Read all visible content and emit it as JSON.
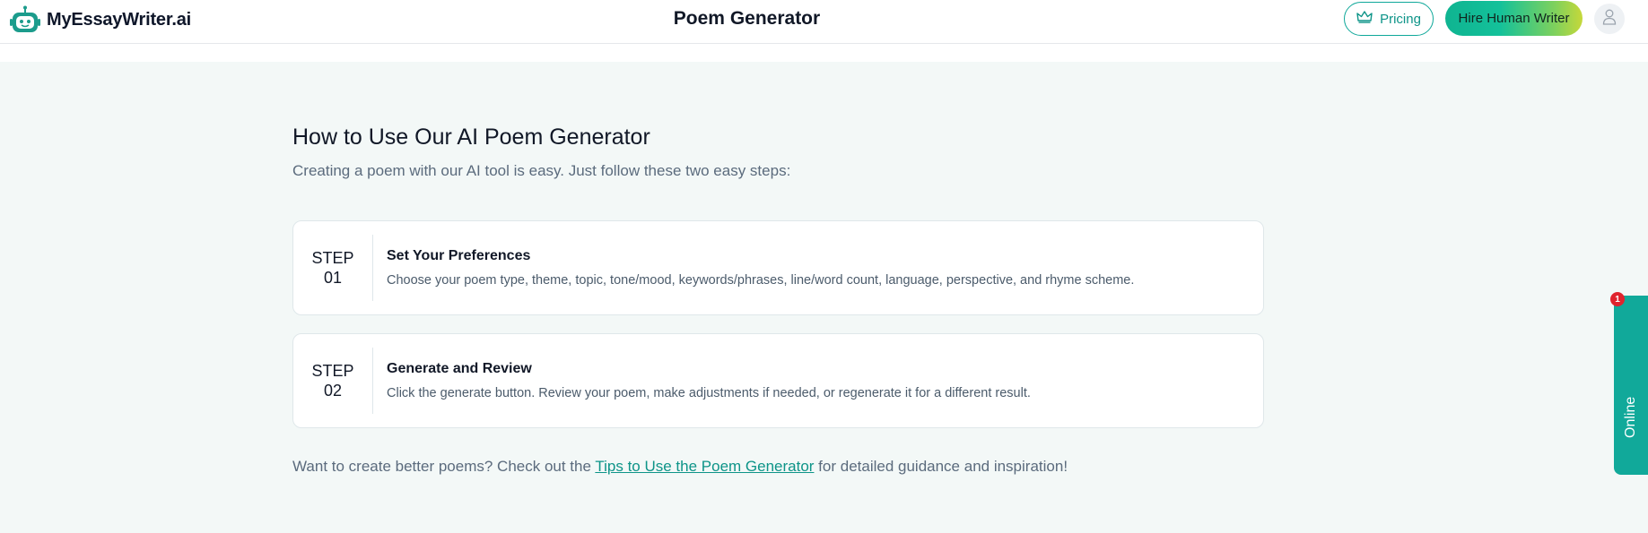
{
  "header": {
    "logo_text": "MyEssayWriter.ai",
    "page_title": "Poem Generator",
    "pricing_label": "Pricing",
    "hire_label": "Hire Human Writer"
  },
  "main": {
    "title": "How to Use Our AI Poem Generator",
    "subtitle": "Creating a poem with our AI tool is easy. Just follow these two easy steps:",
    "steps": [
      {
        "step_word": "STEP",
        "step_num": "01",
        "heading": "Set Your Preferences",
        "description": "Choose your poem type, theme, topic, tone/mood, keywords/phrases, line/word count, language, perspective, and rhyme scheme."
      },
      {
        "step_word": "STEP",
        "step_num": "02",
        "heading": "Generate and Review",
        "description": "Click the generate button. Review your poem, make adjustments if needed, or regenerate it for a different result."
      }
    ],
    "tips_prefix": "Want to create better poems? Check out the ",
    "tips_link": "Tips to Use the Poem Generator",
    "tips_suffix": " for detailed guidance and inspiration!"
  },
  "widget": {
    "online_label": "Online",
    "notification_count": "1"
  },
  "colors": {
    "accent": "#0d9488",
    "background": "#f3f8f7",
    "badge": "#e0242e"
  },
  "icons": {
    "logo": "robot-icon",
    "pricing": "crown-icon",
    "avatar": "user-icon"
  }
}
